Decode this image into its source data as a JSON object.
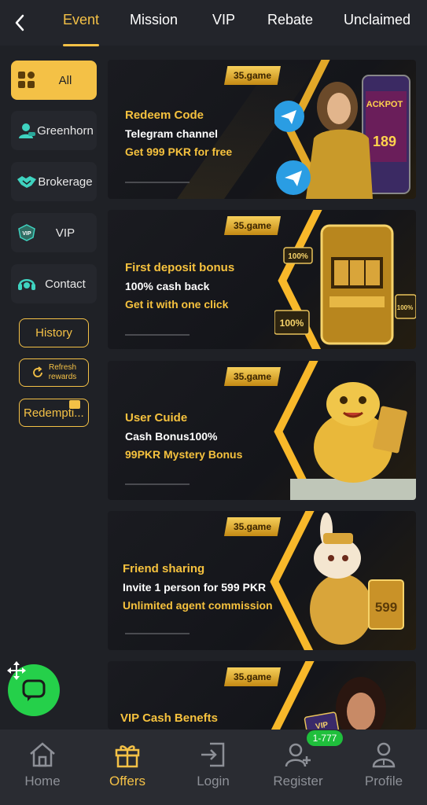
{
  "tabs": [
    {
      "label": "Event",
      "active": true
    },
    {
      "label": "Mission",
      "active": false
    },
    {
      "label": "VIP",
      "active": false
    },
    {
      "label": "Rebate",
      "active": false
    },
    {
      "label": "Unclaimed",
      "active": false
    }
  ],
  "sidebar": {
    "items": [
      {
        "label": "All",
        "icon": "grid-icon",
        "active": true
      },
      {
        "label": "Greenhorn",
        "icon": "user-icon",
        "active": false
      },
      {
        "label": "Brokerage",
        "icon": "handshake-icon",
        "active": false
      },
      {
        "label": "VIP",
        "icon": "vip-icon",
        "active": false
      },
      {
        "label": "Contact",
        "icon": "headset-icon",
        "active": false
      }
    ],
    "history_label": "History",
    "refresh_label_1": "Refresh",
    "refresh_label_2": "rewards",
    "redemption_label": "Redempti..."
  },
  "banners": [
    {
      "brand": "35.game",
      "title": "Redeem Code",
      "line2": "Telegram channel",
      "line3": "Get 999 PKR for free",
      "art_text": "ACKPOT",
      "art_num": "189"
    },
    {
      "brand": "35.game",
      "title": "First deposit bonus",
      "line2": "100% cash back",
      "line3": "Get it with one click",
      "art_text": "100%",
      "art_num": "100%"
    },
    {
      "brand": "35.game",
      "title": "User Cuide",
      "line2": "Cash Bonus100%",
      "line3": "99PKR Mystery Bonus"
    },
    {
      "brand": "35.game",
      "title": "Friend sharing",
      "line2": "Invite 1 person for 599 PKR",
      "line3": "Unlimited agent commission",
      "art_num": "599"
    },
    {
      "brand": "35.game",
      "title": "VIP Cash Benefts",
      "art_text": "VIP"
    }
  ],
  "bottom_nav": {
    "items": [
      {
        "label": "Home",
        "icon": "home-icon",
        "active": false
      },
      {
        "label": "Offers",
        "icon": "gift-icon",
        "active": true
      },
      {
        "label": "Login",
        "icon": "login-icon",
        "active": false
      },
      {
        "label": "Register",
        "icon": "add-user-icon",
        "active": false
      },
      {
        "label": "Profile",
        "icon": "profile-icon",
        "active": false
      }
    ],
    "register_badge": "1-777"
  },
  "colors": {
    "accent": "#f4c146",
    "background": "#1f2126",
    "chat_green": "#25d04a",
    "badge_green": "#1fbf3c"
  }
}
